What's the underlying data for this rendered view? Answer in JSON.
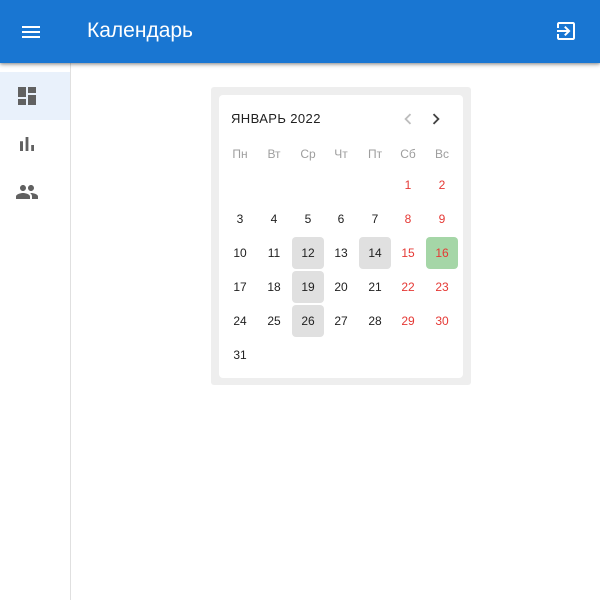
{
  "app": {
    "title": "Календарь"
  },
  "icons": {
    "menu": "menu-icon",
    "logout": "logout-icon",
    "dashboard": "dashboard-icon",
    "chart": "bar-chart-icon",
    "people": "people-icon",
    "prev": "chevron-left-icon",
    "next": "chevron-right-icon"
  },
  "colors": {
    "appbar": "#1976d2",
    "weekend": "#e53935",
    "marked_day": "#e0e0e0",
    "highlighted_day": "#a5d6a7",
    "selected_nav_bg": "#e9f1fb"
  },
  "sidebar": {
    "selected_index": 0
  },
  "calendar": {
    "month_label": "ЯНВАРЬ 2022",
    "weekdays": [
      "Пн",
      "Вт",
      "Ср",
      "Чт",
      "Пт",
      "Сб",
      "Вс"
    ],
    "weeks": [
      [
        "",
        "",
        "",
        "",
        "",
        "1",
        "2"
      ],
      [
        "3",
        "4",
        "5",
        "6",
        "7",
        "8",
        "9"
      ],
      [
        "10",
        "11",
        "12",
        "13",
        "14",
        "15",
        "16"
      ],
      [
        "17",
        "18",
        "19",
        "20",
        "21",
        "22",
        "23"
      ],
      [
        "24",
        "25",
        "26",
        "27",
        "28",
        "29",
        "30"
      ],
      [
        "31",
        "",
        "",
        "",
        "",
        "",
        ""
      ]
    ],
    "marked_days": [
      "12",
      "14",
      "19",
      "26"
    ],
    "highlighted_day": "16"
  }
}
